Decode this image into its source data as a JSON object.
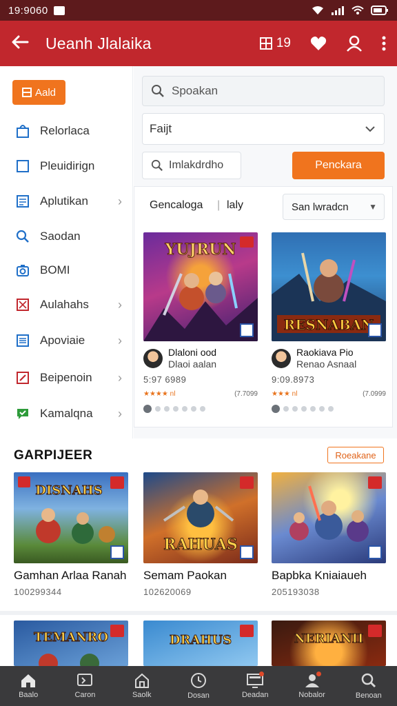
{
  "status_bar": {
    "time": "19:9060"
  },
  "app_bar": {
    "title": "Ueanh Jlalaika",
    "action_text": "19"
  },
  "sidebar": {
    "add_label": "Aald",
    "items": [
      {
        "label": "Relorlaca",
        "icon": "bag-icon",
        "color": "#1f6fc8",
        "chevron": false
      },
      {
        "label": "Pleuidirign",
        "icon": "square-icon",
        "color": "#1f6fc8",
        "chevron": false
      },
      {
        "label": "Aplutikan",
        "icon": "list-icon",
        "color": "#1f6fc8",
        "chevron": true
      },
      {
        "label": "Saodan",
        "icon": "search-icon",
        "color": "#1f6fc8",
        "chevron": false
      },
      {
        "label": "BOMI",
        "icon": "camera-icon",
        "color": "#1f6fc8",
        "chevron": false
      },
      {
        "label": "Aulahahs",
        "icon": "flag-icon",
        "color": "#c1272d",
        "chevron": true
      },
      {
        "label": "Apoviaie",
        "icon": "doc-icon",
        "color": "#1f6fc8",
        "chevron": true
      },
      {
        "label": "Beipenoin",
        "icon": "edit-icon",
        "color": "#c1272d",
        "chevron": true
      },
      {
        "label": "Kamalqna",
        "icon": "chat-icon",
        "color": "#2e9b3a",
        "chevron": true
      }
    ]
  },
  "main": {
    "search_placeholder": "Spoakan",
    "select_value": "Faijt",
    "filter_placeholder": "Imlakdrdho",
    "go_button": "Penckara",
    "tabs": [
      "Gencaloga",
      "laly"
    ],
    "sort_value": "San lwradcn",
    "products": [
      {
        "thumb_title": "YUJRUN",
        "name1": "Dlaloni ood",
        "name2": "Dlaoi aalan",
        "price": "5:97 6989",
        "stars": "★★★★ nl",
        "count": "(7.7099"
      },
      {
        "thumb_title": "RESNABAN",
        "name1": "Raokiava Pio",
        "name2": "Renao Asnaal",
        "price": "9:09.8973",
        "stars": "★★★ nl",
        "count": "(7.0999"
      }
    ]
  },
  "section": {
    "title": "GARPIJEER",
    "see_all": "Roeakane",
    "games": [
      {
        "thumb_title": "DISNAHS",
        "title": "Gamhan Arlaa Ranah",
        "sub": "100299344"
      },
      {
        "thumb_title": "RAHUAS",
        "title": "Semam Paokan",
        "sub": "102620069"
      },
      {
        "thumb_title": "",
        "title": "Bapbka Kniaiaueh",
        "sub": "205193038"
      }
    ],
    "more_games": [
      {
        "thumb_title": "TEMANRO"
      },
      {
        "thumb_title": "DRAHUS"
      },
      {
        "thumb_title": "NERIANII"
      }
    ]
  },
  "bottom_nav": [
    {
      "label": "Baalo",
      "icon": "home-icon"
    },
    {
      "label": "Caron",
      "icon": "tv-icon"
    },
    {
      "label": "Saolk",
      "icon": "store-icon"
    },
    {
      "label": "Dosan",
      "icon": "clock-icon"
    },
    {
      "label": "Deadan",
      "icon": "monitor-icon"
    },
    {
      "label": "Nobalor",
      "icon": "user-icon"
    },
    {
      "label": "Benoan",
      "icon": "search-icon"
    }
  ]
}
